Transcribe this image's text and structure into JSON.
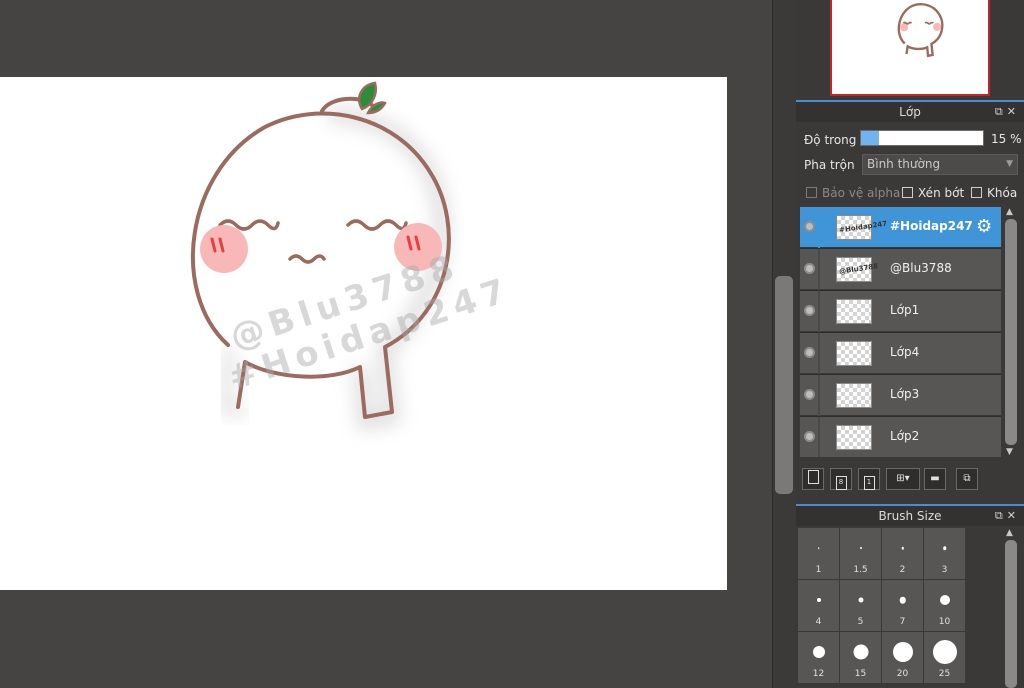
{
  "layer_panel": {
    "title": "Lớp",
    "opacity_label": "Độ trong",
    "opacity_value_text": "15 %",
    "opacity_fraction": 0.15,
    "blend_label": "Pha trộn",
    "blend_value": "Bình thường",
    "protect_alpha_label": "Bảo vệ alpha",
    "clipping_label": "Xén bớt",
    "lock_label": "Khóa",
    "layers": [
      {
        "name": "#Hoidap247",
        "selected": true,
        "thumb_text": "#Hoidap247"
      },
      {
        "name": "@Blu3788",
        "selected": false,
        "thumb_text": "@Blu3788"
      },
      {
        "name": "Lớp1",
        "selected": false,
        "thumb_text": ""
      },
      {
        "name": "Lớp4",
        "selected": false,
        "thumb_text": ""
      },
      {
        "name": "Lớp3",
        "selected": false,
        "thumb_text": ""
      },
      {
        "name": "Lớp2",
        "selected": false,
        "thumb_text": ""
      }
    ]
  },
  "brush_panel": {
    "title": "Brush Size",
    "sizes": [
      "1",
      "1.5",
      "2",
      "3",
      "4",
      "5",
      "7",
      "10",
      "12",
      "15",
      "20",
      "25"
    ]
  },
  "canvas": {
    "watermark_1": "@Blu3788",
    "watermark_2": "#Hoidap247",
    "line_color": "#9a6b5e",
    "blush_color": "#f8b8b8",
    "leaf_color": "#2e8b3a"
  },
  "colors": {
    "accent": "#3f95d8",
    "navigator_frame": "#c2262b"
  }
}
